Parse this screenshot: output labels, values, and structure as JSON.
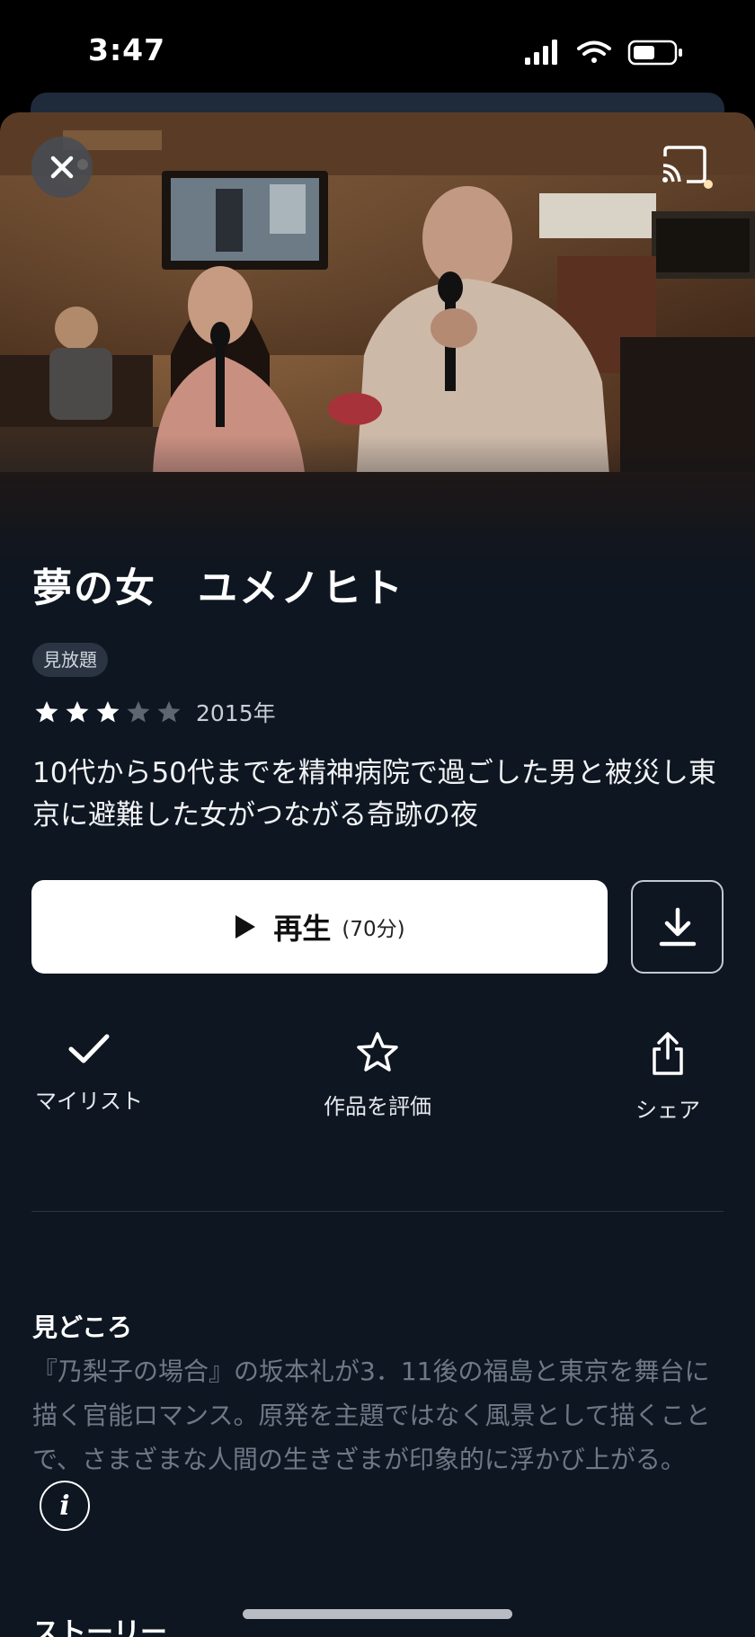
{
  "status_bar": {
    "time": "3:47"
  },
  "video": {
    "title": "夢の女　ユメノヒト",
    "badge": "見放題",
    "rating": 3,
    "rating_max": 5,
    "year": "2015年",
    "description": "10代から50代までを精神病院で過ごした男と被災し東京に避難した女がつながる奇跡の夜"
  },
  "play": {
    "label": "再生",
    "duration": "(70分)"
  },
  "actions": {
    "mylist": "マイリスト",
    "rate": "作品を評価",
    "share": "シェア"
  },
  "highlights": {
    "heading": "見どころ",
    "body": "『乃梨子の場合』の坂本礼が3．11後の福島と東京を舞台に描く官能ロマンス。原発を主題ではなく風景として描くことで、さまざまな人間の生きざまが印象的に浮かび上がる。"
  },
  "story": {
    "heading": "ストーリー"
  },
  "colors": {
    "background": "#0e1621",
    "button_primary": "#ffffff",
    "text_muted": "#6e7886"
  },
  "icons": {
    "close": "close-icon",
    "cast": "cast-icon",
    "play": "play-icon",
    "download": "download-icon",
    "mylist": "checkmark-icon",
    "rate": "star-outline-icon",
    "share": "share-icon",
    "info": "info-icon"
  }
}
